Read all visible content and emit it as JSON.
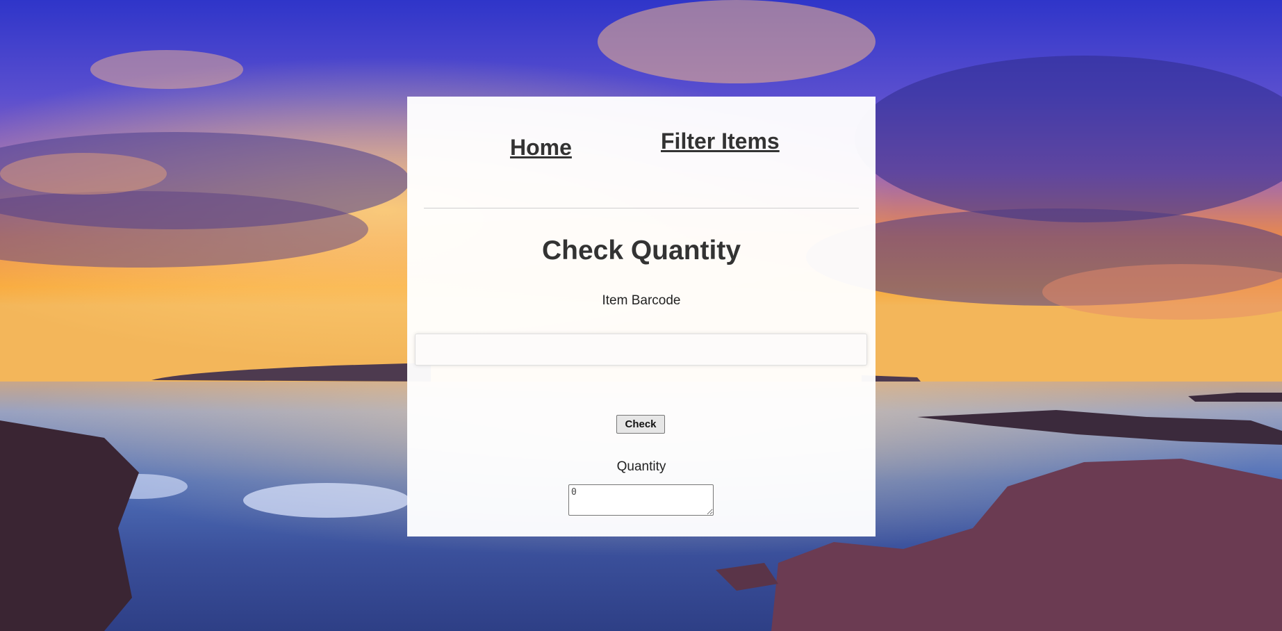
{
  "background": {
    "description_icon": "sunset-ocean-background",
    "colors": {
      "sky_top": "#3b3fc4",
      "sky_mid": "#8a5fb8",
      "horizon": "#f6a53c",
      "sea": "#3f5fae",
      "rocks": "#4a2c3e"
    }
  },
  "nav": {
    "home_label": "Home",
    "filter_label": "Filter Items"
  },
  "main": {
    "title": "Check Quantity",
    "barcode_label": "Item Barcode",
    "barcode_value": "",
    "barcode_placeholder": "",
    "check_label": "Check",
    "quantity_label": "Quantity",
    "quantity_value": "0"
  },
  "colors": {
    "panel": "#ffffff",
    "text": "#333333"
  }
}
